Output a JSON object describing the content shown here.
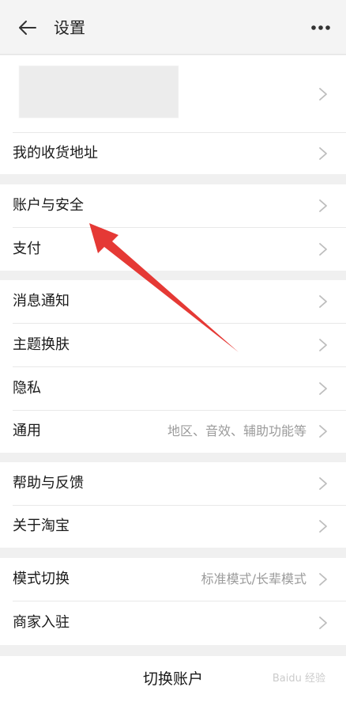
{
  "header": {
    "title": "设置"
  },
  "sections": [
    {
      "rows": [
        {
          "label": "我的收货地址",
          "value": ""
        }
      ]
    },
    {
      "rows": [
        {
          "label": "账户与安全",
          "value": ""
        },
        {
          "label": "支付",
          "value": ""
        }
      ]
    },
    {
      "rows": [
        {
          "label": "消息通知",
          "value": ""
        },
        {
          "label": "主题换肤",
          "value": ""
        },
        {
          "label": "隐私",
          "value": ""
        },
        {
          "label": "通用",
          "value": "地区、音效、辅助功能等"
        }
      ]
    },
    {
      "rows": [
        {
          "label": "帮助与反馈",
          "value": ""
        },
        {
          "label": "关于淘宝",
          "value": ""
        }
      ]
    },
    {
      "rows": [
        {
          "label": "模式切换",
          "value": "标准模式/长辈模式"
        },
        {
          "label": "商家入驻",
          "value": ""
        }
      ]
    }
  ],
  "footer": {
    "switch_account": "切换账户"
  },
  "watermark": "Baidu 经验",
  "colors": {
    "annotation_arrow": "#e53935",
    "chevron": "#bdbdbd"
  },
  "icons": [
    "back-arrow-icon",
    "more-dots-icon",
    "chevron-right-icon"
  ]
}
